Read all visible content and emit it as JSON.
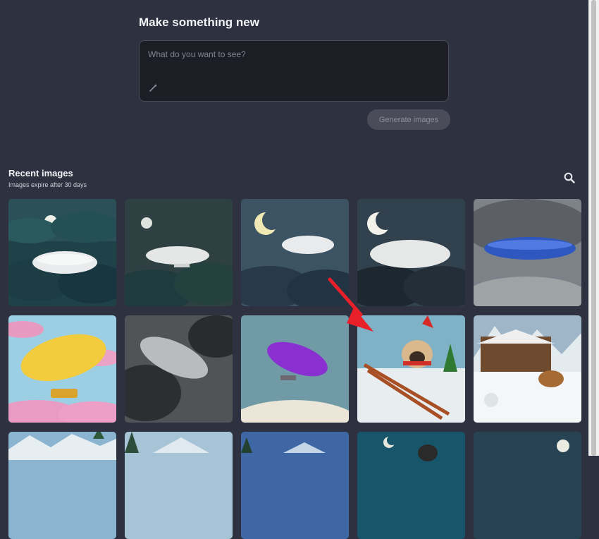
{
  "create": {
    "title": "Make something new",
    "placeholder": "What do you want to see?",
    "generate_label": "Generate images"
  },
  "recent": {
    "title": "Recent images",
    "subtitle": "Images expire after 30 days"
  },
  "icons": [
    "magic-wand-icon",
    "search-icon"
  ],
  "colors": {
    "background": "#2e3140",
    "arrow": "#e8202a"
  }
}
